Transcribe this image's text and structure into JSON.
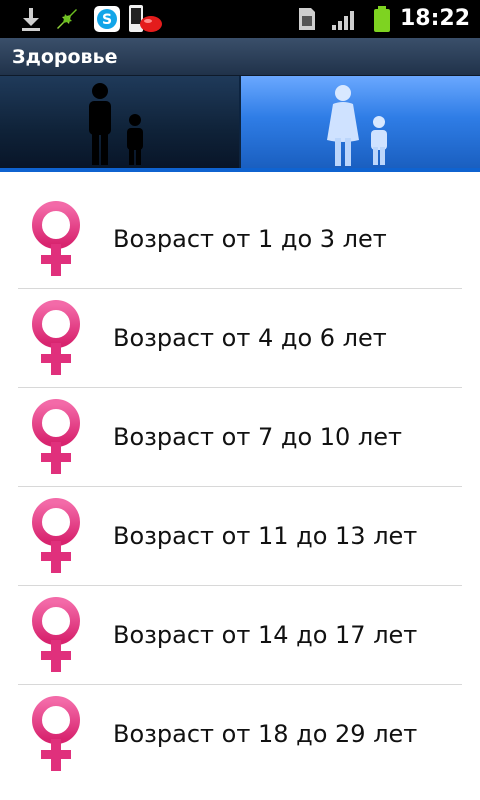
{
  "status_bar": {
    "icons": [
      "download-icon",
      "sync-icon",
      "skype-icon",
      "phone-notification-icon",
      "sim-card-icon",
      "signal-icon",
      "battery-icon"
    ],
    "time": "18:22"
  },
  "header": {
    "title": "Здоровье"
  },
  "tabs": [
    {
      "name": "adult-with-child",
      "icon": "adult-child-silhouette-icon",
      "selected": false
    },
    {
      "name": "mother-with-child",
      "icon": "mother-child-silhouette-icon",
      "selected": true
    }
  ],
  "list": {
    "icon": "female-symbol-icon",
    "accent_color": "#e83e8c",
    "items": [
      {
        "label": "Возраст от 1 до 3 лет"
      },
      {
        "label": "Возраст от 4 до 6 лет"
      },
      {
        "label": "Возраст от 7 до 10 лет"
      },
      {
        "label": "Возраст от 11 до 13 лет"
      },
      {
        "label": "Возраст от 14 до 17 лет"
      },
      {
        "label": "Возраст от 18 до 29 лет"
      }
    ]
  }
}
